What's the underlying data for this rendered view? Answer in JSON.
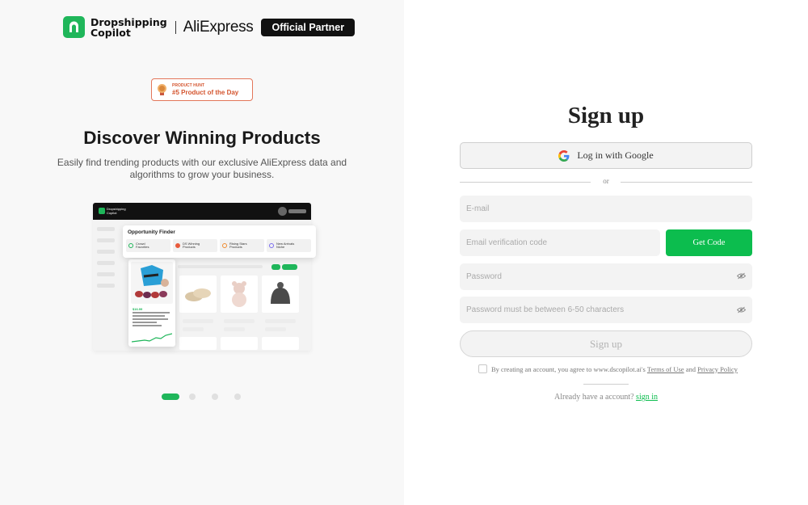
{
  "brand": {
    "name_line1": "Dropshipping",
    "name_line2": "Copilot",
    "partner_name": "AliExpress",
    "partner_badge": "Official Partner"
  },
  "award": {
    "label_small": "PRODUCT HUNT",
    "label": "#5 Product of the Day"
  },
  "hero": {
    "headline": "Discover Winning Products",
    "subline": "Easily find trending products with our exclusive AliExpress data and algorithms to grow your business."
  },
  "preview": {
    "brand_line1": "Dropshipping",
    "brand_line2": "Copilot",
    "finder_title": "Opportunity Finder",
    "tabs": [
      {
        "line1": "Crowd",
        "line2": "Favorites",
        "color": "#1fb65a"
      },
      {
        "line1": "DS Winning",
        "line2": "Products",
        "color": "#e85b3c"
      },
      {
        "line1": "Rising Stars",
        "line2": "Products",
        "color": "#f08a2e"
      },
      {
        "line1": "New Arrivals",
        "line2": "Niche",
        "color": "#7a6cf0"
      }
    ],
    "card_price": "$16.99"
  },
  "carousel": {
    "slides": 4,
    "active_index": 0
  },
  "signup": {
    "title": "Sign up",
    "google_label": "Log in with Google",
    "or_text": "or",
    "email_placeholder": "E-mail",
    "code_placeholder": "Email verification code",
    "get_code_label": "Get Code",
    "password_placeholder": "Password",
    "password_confirm_placeholder": "Password must be between 6-50 characters",
    "submit_label": "Sign up",
    "terms_prefix": "By creating an account, you agree to www.dscopilot.ai's",
    "terms_link": "Terms of Use",
    "terms_and": "and",
    "privacy_link": "Privacy Policy",
    "have_account_text": "Already have a account?",
    "signin_link": "sign in"
  },
  "colors": {
    "brand_green": "#1fb65a",
    "button_green": "#0cbd4e",
    "award_orange": "#d4552f"
  }
}
